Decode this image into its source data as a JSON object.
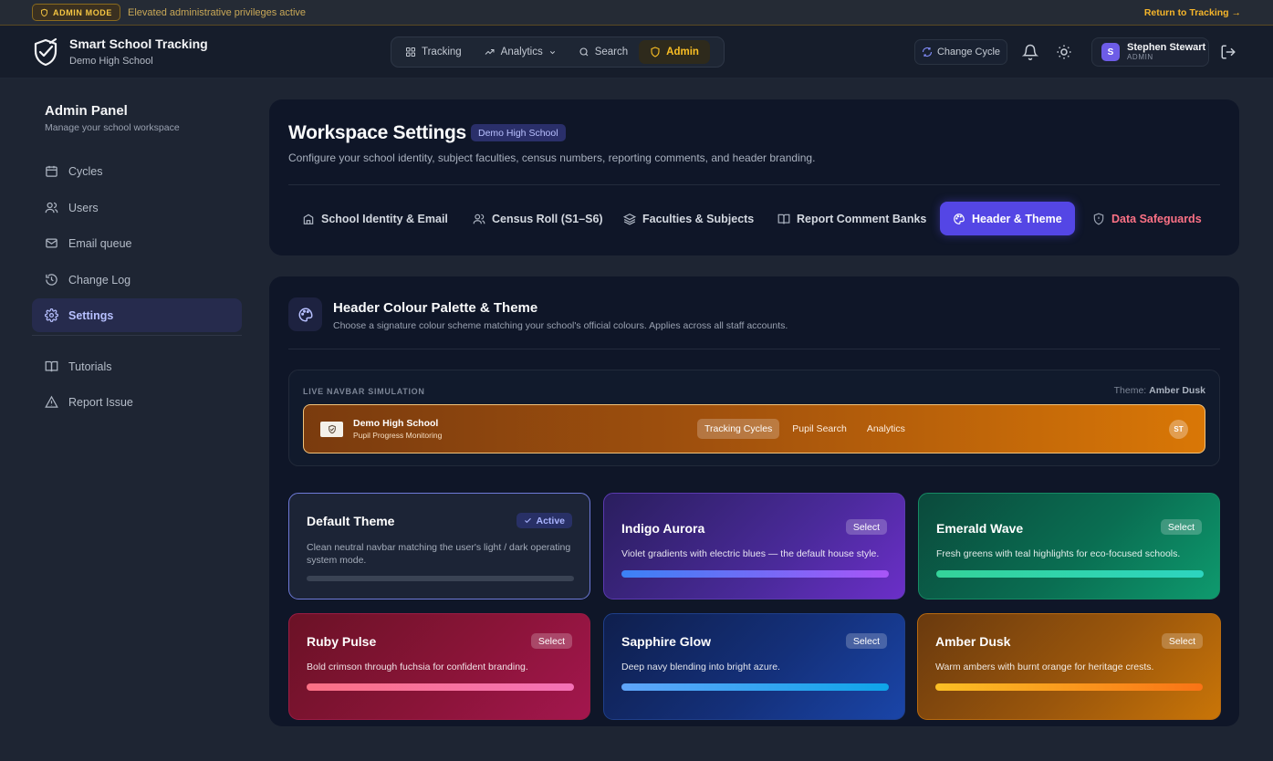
{
  "banner": {
    "badge": "ADMIN MODE",
    "message": "Elevated administrative privileges active",
    "return_link": "Return to Tracking →"
  },
  "header": {
    "app_title": "Smart School Tracking",
    "school": "Demo High School",
    "nav": [
      {
        "label": "Tracking",
        "icon": "grid-icon"
      },
      {
        "label": "Analytics",
        "icon": "trend-icon"
      },
      {
        "label": "Search",
        "icon": "search-icon"
      },
      {
        "label": "Admin",
        "icon": "shield-icon"
      }
    ],
    "change_cycle": "Change Cycle",
    "user_initial": "S",
    "user_name": "Stephen Stewart",
    "user_role": "ADMIN"
  },
  "sidebar": {
    "title": "Admin Panel",
    "subtitle": "Manage your school workspace",
    "items": [
      {
        "label": "Cycles",
        "icon": "calendar-icon"
      },
      {
        "label": "Users",
        "icon": "users-icon"
      },
      {
        "label": "Email queue",
        "icon": "mail-icon"
      },
      {
        "label": "Change Log",
        "icon": "history-icon"
      },
      {
        "label": "Settings",
        "icon": "gear-icon"
      },
      {
        "label": "Tutorials",
        "icon": "book-icon"
      },
      {
        "label": "Report Issue",
        "icon": "warning-icon"
      }
    ]
  },
  "workspace": {
    "title": "Workspace Settings",
    "school_chip": "Demo High School",
    "subtitle": "Configure your school identity, subject faculties, census numbers, reporting comments, and header branding.",
    "tabs": [
      {
        "label": "School Identity & Email",
        "icon": "building-icon"
      },
      {
        "label": "Census Roll (S1–S6)",
        "icon": "users-icon"
      },
      {
        "label": "Faculties & Subjects",
        "icon": "layers-icon"
      },
      {
        "label": "Report Comment Banks",
        "icon": "book-icon"
      },
      {
        "label": "Header & Theme",
        "icon": "palette-icon"
      },
      {
        "label": "Data Safeguards",
        "icon": "shield-icon"
      }
    ]
  },
  "theme_panel": {
    "title": "Header Colour Palette & Theme",
    "subtitle": "Choose a signature colour scheme matching your school's official colours. Applies across all staff accounts.",
    "sim_label": "LIVE NAVBAR SIMULATION",
    "sim_theme_prefix": "Theme:",
    "sim_theme_name": "Amber Dusk",
    "sim_school": "Demo High School",
    "sim_tagline": "Pupil Progress Monitoring",
    "sim_links": [
      "Tracking Cycles",
      "Pupil Search",
      "Analytics"
    ],
    "sim_avatar": "ST",
    "themes": [
      {
        "name": "Default Theme",
        "badge": "Active",
        "desc": "Clean neutral navbar matching the user's light / dark operating system mode."
      },
      {
        "name": "Indigo Aurora",
        "badge": "Select",
        "desc": "Violet gradients with electric blues — the default house style."
      },
      {
        "name": "Emerald Wave",
        "badge": "Select",
        "desc": "Fresh greens with teal highlights for eco-focused schools."
      },
      {
        "name": "Ruby Pulse",
        "badge": "Select",
        "desc": "Bold crimson through fuchsia for confident branding."
      },
      {
        "name": "Sapphire Glow",
        "badge": "Select",
        "desc": "Deep navy blending into bright azure."
      },
      {
        "name": "Amber Dusk",
        "badge": "Select",
        "desc": "Warm ambers with burnt orange for heritage crests."
      }
    ]
  },
  "colors": {
    "accent": "#5446e5",
    "admin_gold": "#fbbf24",
    "danger": "#fb7185"
  }
}
